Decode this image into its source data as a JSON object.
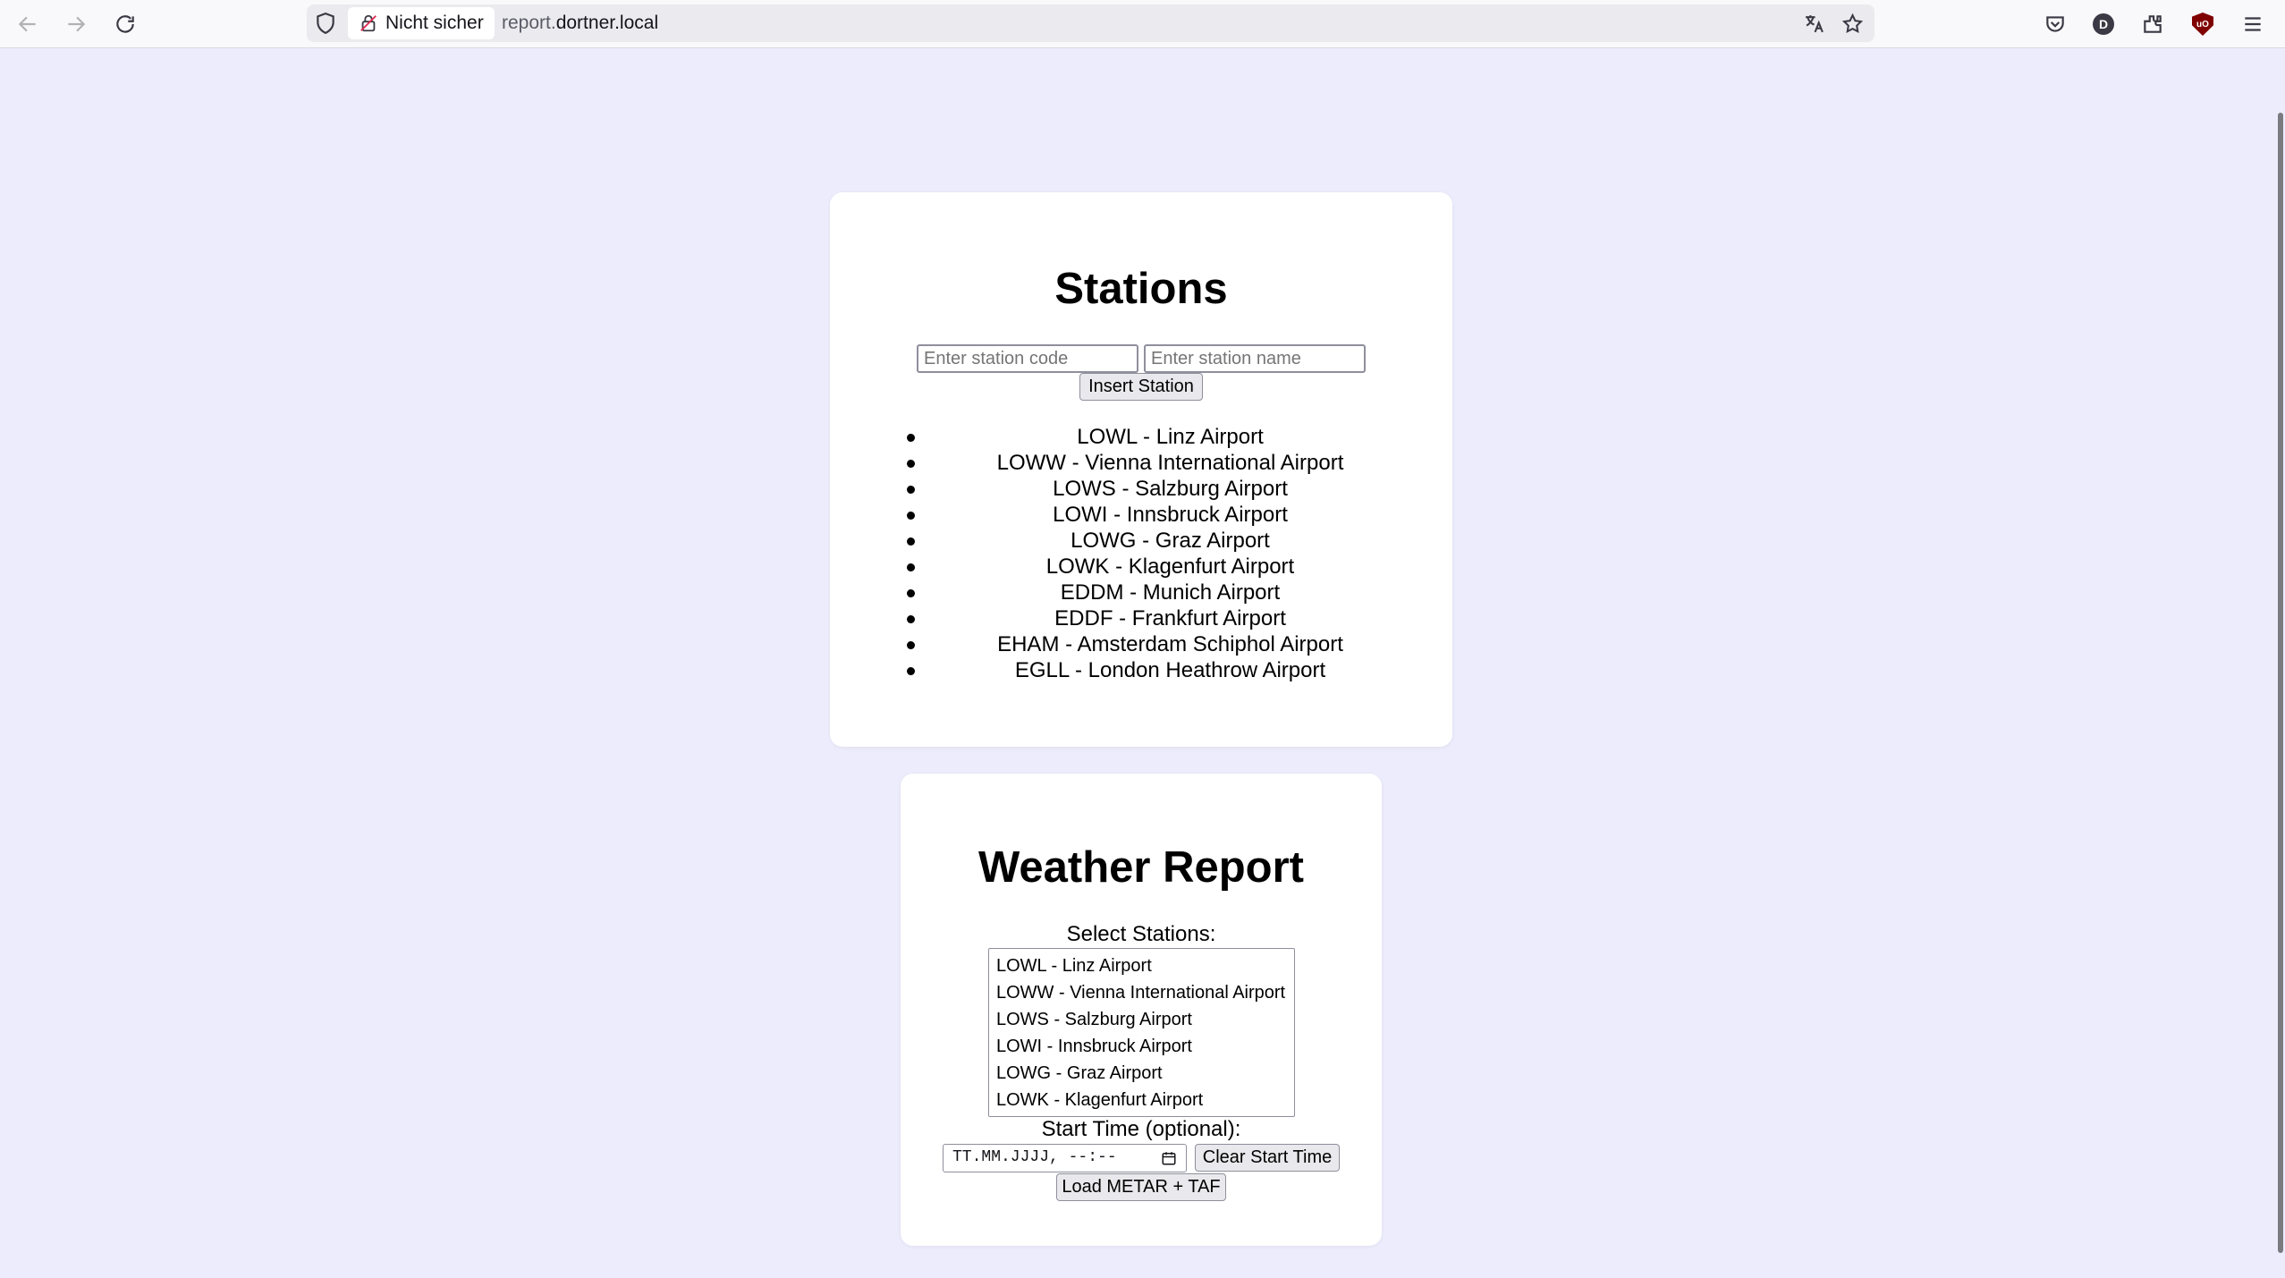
{
  "browser": {
    "security_label": "Nicht sicher",
    "url_subdomain": "report.",
    "url_domain": "dortner.local",
    "profile_initial": "D",
    "ublock_label": "uO"
  },
  "stations": {
    "title": "Stations",
    "code_placeholder": "Enter station code",
    "name_placeholder": "Enter station name",
    "insert_button": "Insert Station",
    "items": [
      "LOWL - Linz Airport",
      "LOWW - Vienna International Airport",
      "LOWS - Salzburg Airport",
      "LOWI - Innsbruck Airport",
      "LOWG - Graz Airport",
      "LOWK - Klagenfurt Airport",
      "EDDM - Munich Airport",
      "EDDF - Frankfurt Airport",
      "EHAM - Amsterdam Schiphol Airport",
      "EGLL - London Heathrow Airport"
    ]
  },
  "weather": {
    "title": "Weather Report",
    "select_label": "Select Stations:",
    "options": [
      "LOWL - Linz Airport",
      "LOWW - Vienna International Airport",
      "LOWS - Salzburg Airport",
      "LOWI - Innsbruck Airport",
      "LOWG - Graz Airport",
      "LOWK - Klagenfurt Airport"
    ],
    "start_time_label": "Start Time (optional):",
    "datetime_value": "TT.MM.JJJJ, --:--",
    "clear_button": "Clear Start Time",
    "load_button": "Load METAR + TAF"
  }
}
